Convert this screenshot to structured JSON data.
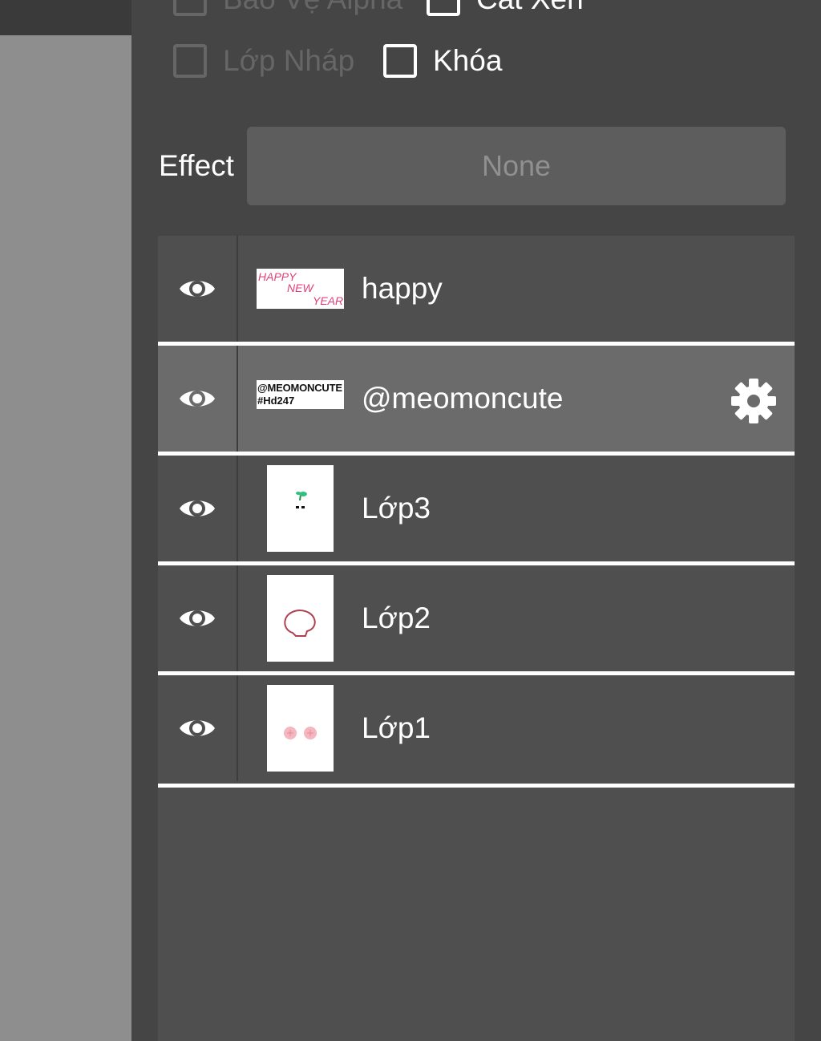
{
  "options": {
    "alpha_protect": {
      "label": "Bảo Vệ Alpha",
      "checked": false,
      "enabled": false
    },
    "clipping": {
      "label": "Cắt Xén",
      "checked": false,
      "enabled": true
    },
    "draft_layer": {
      "label": "Lớp Nháp",
      "checked": false,
      "enabled": false
    },
    "lock": {
      "label": "Khóa",
      "checked": false,
      "enabled": true
    }
  },
  "effect": {
    "label": "Effect",
    "value": "None"
  },
  "layers": [
    {
      "name": "happy",
      "visible": true,
      "selected": false,
      "thumb_text": [
        "HAPPY",
        "NEW",
        "YEAR"
      ]
    },
    {
      "name": "@meomoncute",
      "visible": true,
      "selected": true,
      "thumb_text": [
        "@MEOMONCUTE",
        "#Hd247"
      ]
    },
    {
      "name": "Lớp3",
      "visible": true,
      "selected": false
    },
    {
      "name": "Lớp2",
      "visible": true,
      "selected": false
    },
    {
      "name": "Lớp1",
      "visible": true,
      "selected": false
    }
  ],
  "colors": {
    "panel": "#454545",
    "list": "#4f4f4f",
    "selected_row": "#6b6b6b",
    "text": "#ffffff",
    "disabled": "#666666",
    "thumb_pink": "#e0407a"
  },
  "icons": {
    "visibility": "eye-icon",
    "settings": "gear-icon"
  }
}
